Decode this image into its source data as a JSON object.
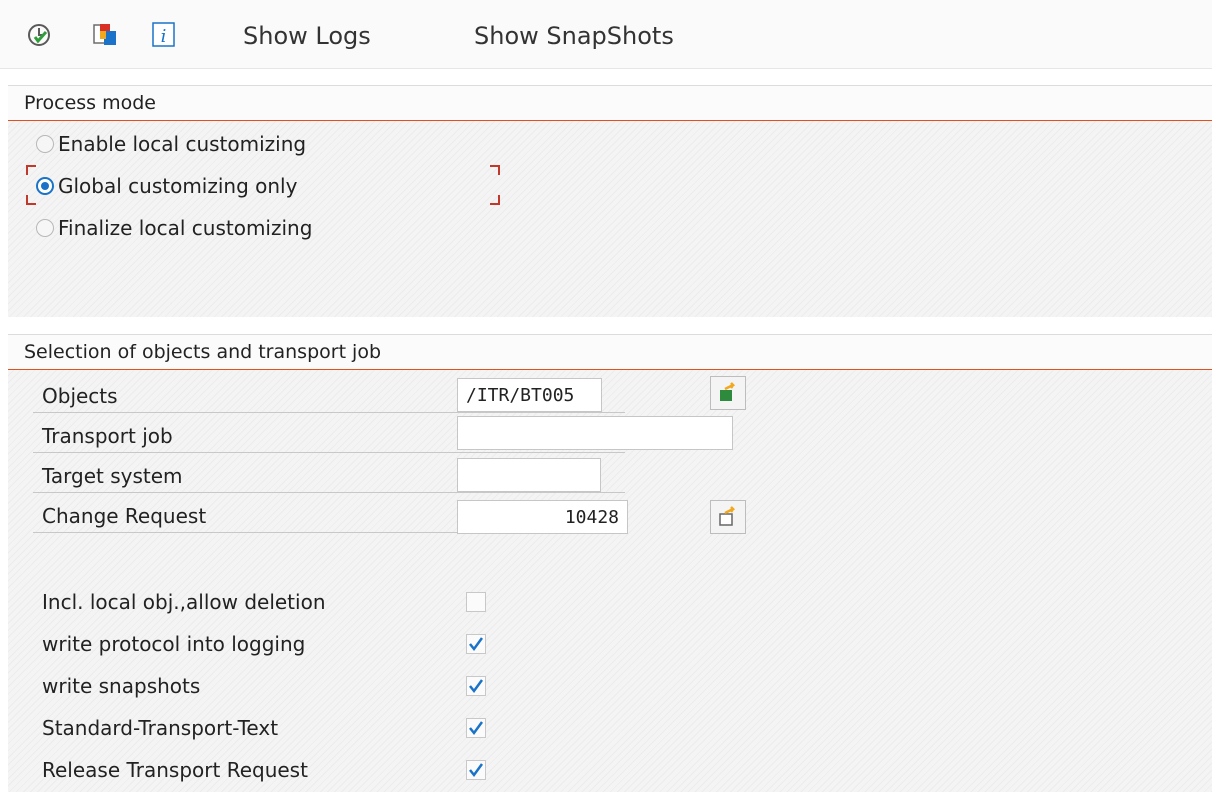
{
  "toolbar": {
    "icons": [
      "execute-icon",
      "copy-objects-icon",
      "info-icon"
    ],
    "show_logs": "Show Logs",
    "show_snapshots": "Show SnapShots"
  },
  "process_mode": {
    "title": "Process mode",
    "options": [
      {
        "label": "Enable local customizing",
        "selected": false
      },
      {
        "label": "Global customizing only",
        "selected": true
      },
      {
        "label": "Finalize local customizing",
        "selected": false
      }
    ]
  },
  "selection": {
    "title": "Selection of objects and transport job",
    "fields": {
      "objects": {
        "label": "Objects",
        "value": "/ITR/BT005"
      },
      "transport_job": {
        "label": "Transport job",
        "value": ""
      },
      "target_system": {
        "label": "Target system",
        "value": ""
      },
      "change_request": {
        "label": "Change Request",
        "value": "10428"
      }
    },
    "checkboxes": [
      {
        "label": "Incl. local obj.,allow deletion",
        "checked": false
      },
      {
        "label": "write protocol into logging",
        "checked": true
      },
      {
        "label": "write snapshots",
        "checked": true
      },
      {
        "label": "Standard-Transport-Text",
        "checked": true
      },
      {
        "label": "Release Transport Request",
        "checked": true
      }
    ]
  },
  "colors": {
    "accent": "#e2511d",
    "radio_selected": "#1a73c8",
    "check": "#1a73c8"
  }
}
